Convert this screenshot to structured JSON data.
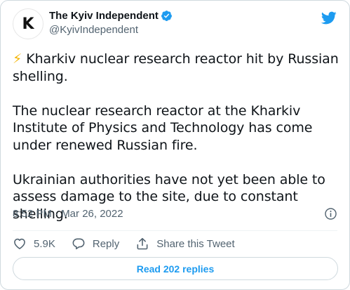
{
  "account": {
    "avatar_letter": "K",
    "display_name": "The Kyiv Independent",
    "handle": "@KyivIndependent",
    "verified_icon": "verified-badge-icon",
    "platform_icon": "twitter-bird-icon"
  },
  "tweet": {
    "emoji": "⚡",
    "paragraphs": [
      "Kharkiv nuclear research reactor hit by Russian shelling.",
      "The nuclear research reactor at the Kharkiv Institute of Physics and Technology has come under renewed Russian fire.",
      "Ukrainian authorities have not yet been able to assess damage to the site, due to constant shelling."
    ],
    "timestamp": "8:52 PM · Mar 26, 2022"
  },
  "actions": {
    "like_count": "5.9K",
    "reply_label": "Reply",
    "share_label": "Share this Tweet"
  },
  "replies_button": "Read 202 replies",
  "colors": {
    "accent": "#1d9bf0",
    "secondary_text": "#536471",
    "border": "#cfd9de"
  }
}
